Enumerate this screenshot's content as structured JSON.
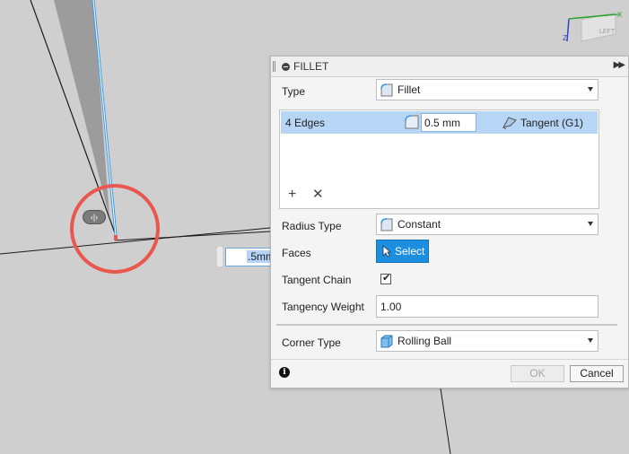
{
  "dialog": {
    "title": "FILLET",
    "type_label": "Type",
    "type_value": "Fillet",
    "edges": {
      "count_label": "4 Edges",
      "radius_value": "0.5 mm",
      "continuity": "Tangent (G1)"
    },
    "radius_type_label": "Radius Type",
    "radius_type_value": "Constant",
    "faces_label": "Faces",
    "select_label": "Select",
    "tangent_chain_label": "Tangent Chain",
    "tangent_chain_checked": true,
    "tangency_weight_label": "Tangency Weight",
    "tangency_weight_value": "1.00",
    "corner_type_label": "Corner Type",
    "corner_type_value": "Rolling Ball",
    "ok_label": "OK",
    "cancel_label": "Cancel"
  },
  "canvas": {
    "radius_input_value": ".5mm",
    "viewcube_face": "LEFT",
    "axis_labels": [
      "X",
      "Z"
    ],
    "selection_circle_color": "#e8584e",
    "edge_highlight_color": "#3a9bea"
  },
  "colors": {
    "accent": "#1d8fe0",
    "row_selected": "#b7d6f5"
  }
}
